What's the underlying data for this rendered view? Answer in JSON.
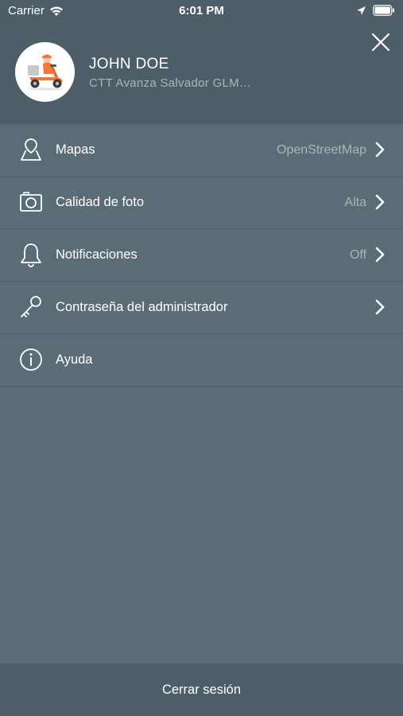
{
  "status_bar": {
    "carrier": "Carrier",
    "time": "6:01 PM",
    "icons": [
      "wifi-icon",
      "location-arrow-icon",
      "battery-icon"
    ]
  },
  "header": {
    "user_name": "JOHN DOE",
    "organization": "CTT Avanza Salvador GLM…",
    "avatar": "delivery-scooter-illustration",
    "close_icon": "close-icon"
  },
  "menu": {
    "items": [
      {
        "icon": "map-pin-icon",
        "label": "Mapas",
        "value": "OpenStreetMap"
      },
      {
        "icon": "camera-icon",
        "label": "Calidad de foto",
        "value": "Alta"
      },
      {
        "icon": "bell-icon",
        "label": "Notificaciones",
        "value": "Off"
      },
      {
        "icon": "key-icon",
        "label": "Contraseña del administrador",
        "value": ""
      },
      {
        "icon": "info-icon",
        "label": "Ayuda",
        "value": ""
      }
    ]
  },
  "footer": {
    "logout_label": "Cerrar sesión"
  },
  "colors": {
    "header_bg": "#4e5e68",
    "body_bg": "#5b6c76",
    "secondary_text": "#a9b5bc",
    "accent_orange": "#f2773a"
  }
}
